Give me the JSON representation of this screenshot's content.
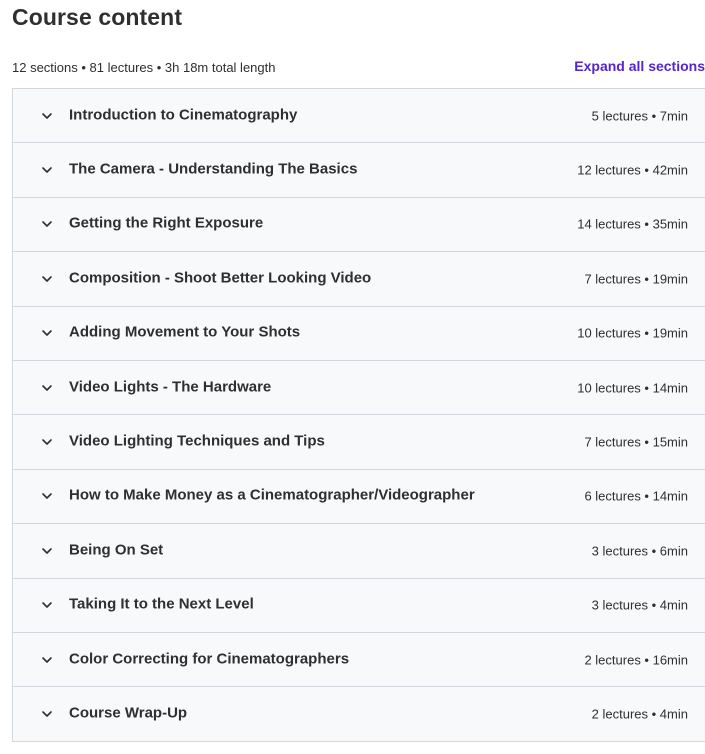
{
  "header": {
    "title": "Course content",
    "summary": "12 sections • 81 lectures • 3h 18m total length",
    "expand_all_label": "Expand all sections"
  },
  "icons": {
    "section_toggle": "chevron-down-icon"
  },
  "colors": {
    "accent": "#5624d0",
    "row_background": "#f7f9fa",
    "border": "#d1d7dc",
    "text": "#2d2f31"
  },
  "sections": [
    {
      "title": "Introduction to Cinematography",
      "meta": "5 lectures • 7min"
    },
    {
      "title": "The Camera - Understanding The Basics",
      "meta": "12 lectures • 42min"
    },
    {
      "title": "Getting the Right Exposure",
      "meta": "14 lectures • 35min"
    },
    {
      "title": "Composition - Shoot Better Looking Video",
      "meta": "7 lectures • 19min"
    },
    {
      "title": "Adding Movement to Your Shots",
      "meta": "10 lectures • 19min"
    },
    {
      "title": "Video Lights - The Hardware",
      "meta": "10 lectures • 14min"
    },
    {
      "title": "Video Lighting Techniques and Tips",
      "meta": "7 lectures • 15min"
    },
    {
      "title": "How to Make Money as a Cinematographer/Videographer",
      "meta": "6 lectures • 14min"
    },
    {
      "title": "Being On Set",
      "meta": "3 lectures • 6min"
    },
    {
      "title": "Taking It to the Next Level",
      "meta": "3 lectures • 4min"
    },
    {
      "title": "Color Correcting for Cinematographers",
      "meta": "2 lectures • 16min"
    },
    {
      "title": "Course Wrap-Up",
      "meta": "2 lectures • 4min"
    }
  ]
}
